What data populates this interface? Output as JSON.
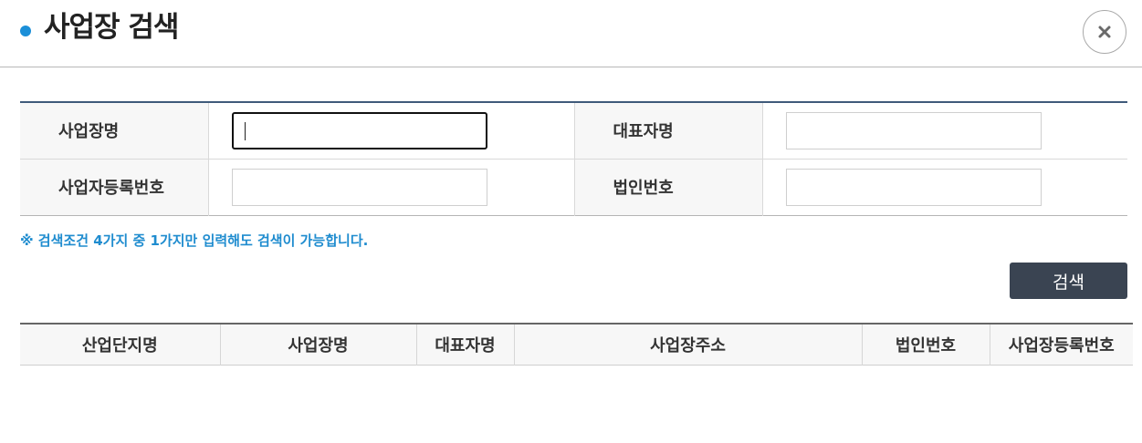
{
  "header": {
    "title": "사업장 검색",
    "close_icon": "close-icon"
  },
  "form": {
    "rows": [
      [
        {
          "label": "사업장명",
          "value": "",
          "placeholder": ""
        },
        {
          "label": "대표자명",
          "value": "",
          "placeholder": ""
        }
      ],
      [
        {
          "label": "사업자등록번호",
          "value": "",
          "placeholder": ""
        },
        {
          "label": "법인번호",
          "value": "",
          "placeholder": ""
        }
      ]
    ]
  },
  "notice": "※ 검색조건 4가지 중 1가지만 입력해도 검색이 가능합니다.",
  "search_button": "검색",
  "results": {
    "columns": [
      "산업단지명",
      "사업장명",
      "대표자명",
      "사업장주소",
      "법인번호",
      "사업장등록번호"
    ],
    "rows": []
  },
  "colors": {
    "accent": "#1b8fd8",
    "notice": "#1f8ccf",
    "button_bg": "#3a4452",
    "table_top_border": "#3f5a7a"
  }
}
